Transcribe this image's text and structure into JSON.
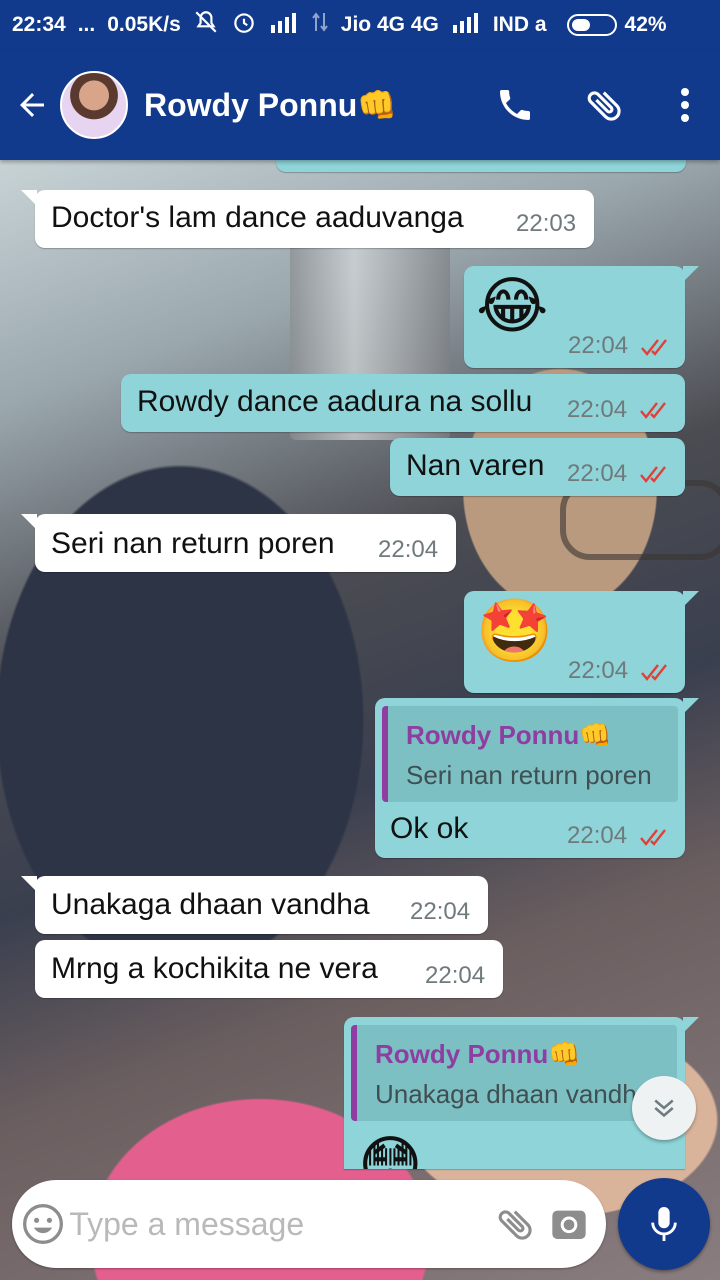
{
  "status_bar": {
    "time": "22:34",
    "dots": "...",
    "speed": "0.05K/s",
    "carrier": "Jio 4G 4G",
    "carrier2": "IND a",
    "battery": "42%"
  },
  "header": {
    "contact_name": "Rowdy Ponnu👊"
  },
  "messages": [
    {
      "text": "Doctor's lam dance aaduvanga",
      "time": "22:03"
    },
    {
      "text": "😂",
      "time": "22:04"
    },
    {
      "text": "Rowdy dance aadura na sollu",
      "time": "22:04"
    },
    {
      "text": "Nan varen",
      "time": "22:04"
    },
    {
      "text": "Seri nan return poren",
      "time": "22:04"
    },
    {
      "text": "🤩",
      "time": "22:04"
    },
    {
      "quote_name": "Rowdy Ponnu👊",
      "quote_text": "Seri nan return poren",
      "text": "Ok ok",
      "time": "22:04"
    },
    {
      "text": "Unakaga dhaan vandha",
      "time": "22:04"
    },
    {
      "text": "Mrng a kochikita ne vera",
      "time": "22:04"
    },
    {
      "quote_name": "Rowdy Ponnu👊",
      "quote_text": "Unakaga dhaan vandha",
      "text": "😳"
    }
  ],
  "composer": {
    "placeholder": "Type a message"
  },
  "colors": {
    "app_bar": "#123a8c",
    "outgoing_bubble": "#8ed4d8",
    "incoming_bubble": "#ffffff",
    "read_ticks": "#e0403a",
    "quote_accent": "#8e3ea0"
  }
}
